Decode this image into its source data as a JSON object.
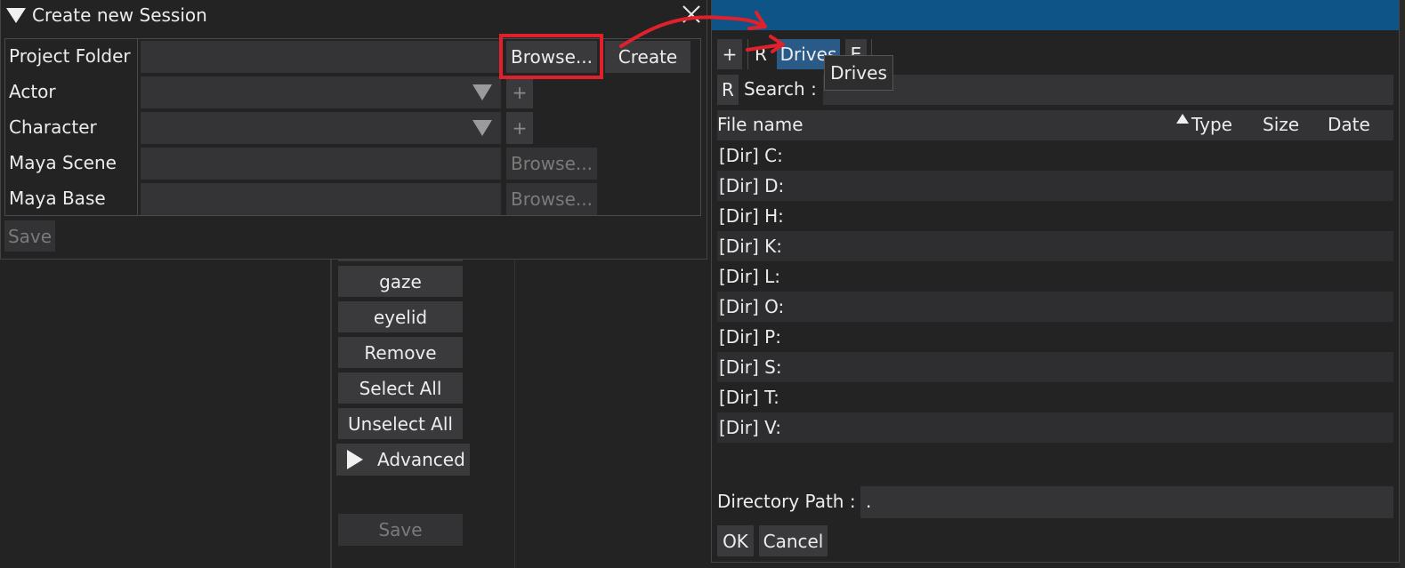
{
  "session_dialog": {
    "title": "Create new Session",
    "rows": [
      {
        "label": "Project Folder"
      },
      {
        "label": "Actor"
      },
      {
        "label": "Character"
      },
      {
        "label": "Maya Scene"
      },
      {
        "label": "Maya Base"
      }
    ],
    "browse_label": "Browse...",
    "create_label": "Create",
    "plus_label": "+",
    "save_label": "Save"
  },
  "middle_panel": {
    "buttons": [
      "gaze",
      "eyelid",
      "Remove",
      "Select All",
      "Unselect All"
    ],
    "advanced_label": "Advanced",
    "save_label": "Save"
  },
  "file_dialog": {
    "toolbar": {
      "plus": "+",
      "r": "R",
      "drives": "Drives",
      "e": "E"
    },
    "tooltip": "Drives",
    "search_r": "R",
    "search_label": "Search :",
    "columns": {
      "name": "File name",
      "type": "Type",
      "size": "Size",
      "date": "Date"
    },
    "entries": [
      "[Dir] C:",
      "[Dir] D:",
      "[Dir] H:",
      "[Dir] K:",
      "[Dir] L:",
      "[Dir] O:",
      "[Dir] P:",
      "[Dir] S:",
      "[Dir] T:",
      "[Dir] V:"
    ],
    "directory_path_label": "Directory Path :",
    "directory_path_value": ".",
    "ok_label": "OK",
    "cancel_label": "Cancel"
  },
  "colors": {
    "titlebar_blue": "#0f5487",
    "highlight_red": "#e0212b",
    "drives_blue": "#2a5a88"
  }
}
